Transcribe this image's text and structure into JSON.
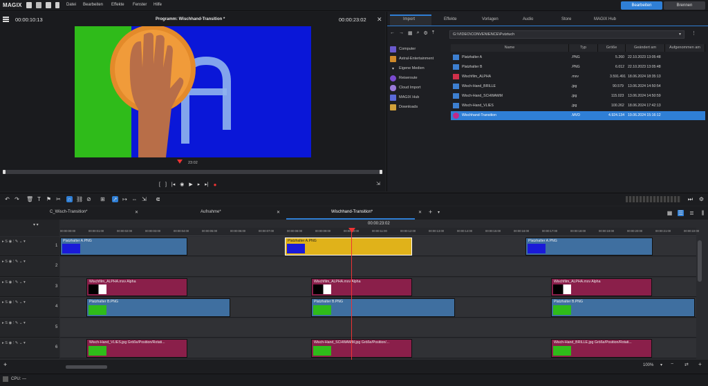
{
  "app": {
    "brand": "MAGIX"
  },
  "menu": [
    "Datei",
    "Bearbeiten",
    "Effekte",
    "Fenster",
    "Hilfe"
  ],
  "top_buttons": {
    "edit": "Bearbeiten",
    "burn": "Brennen"
  },
  "program": {
    "title": "Programm: Wischhand-Transition *",
    "time_left": "00:00:10:13",
    "time_right": "00:00:23:02",
    "position": "23:02"
  },
  "media_tabs": [
    "Import",
    "Effekte",
    "Vorlagen",
    "Audio",
    "Store",
    "MAGIX Hub"
  ],
  "path": "G:\\VIDEO\\CONVENIENCE\\Putztuch",
  "sidebar": [
    "Computer",
    "Astral-Entertainment",
    "Eigene Medien",
    "Reiseroute",
    "Cloud Import",
    "MAGIX Hub",
    "Downloads"
  ],
  "file_columns": [
    "Name",
    "Typ",
    "Größe",
    "Geändert am",
    "Aufgenommen am"
  ],
  "files": [
    {
      "name": "Platzhalter A",
      "type": ".PNG",
      "size": "5.260",
      "date": "22.10.2023 13:05:48"
    },
    {
      "name": "Platzhalter B",
      "type": ".PNG",
      "size": "6.012",
      "date": "22.10.2023 13:05:48"
    },
    {
      "name": "Wischfilm_ALPHA",
      "type": ".mxv",
      "size": "3.591.491",
      "date": "18.06.2024 18:35:13"
    },
    {
      "name": "Wisch-Hand_BRILLE",
      "type": ".jpg",
      "size": "90.579",
      "date": "13.06.2024 14:50:54"
    },
    {
      "name": "Wisch-Hand_SCHWAMM",
      "type": ".jpg",
      "size": "115.023",
      "date": "13.06.2024 14:50:59"
    },
    {
      "name": "Wisch-Hand_VLIES",
      "type": ".jpg",
      "size": "100.262",
      "date": "18.06.2024 17:42:13"
    },
    {
      "name": "Wischhand-Transition",
      "type": ".MVD",
      "size": "4.924.134",
      "date": "19.06.2024 15:16:12"
    }
  ],
  "timeline_tabs": [
    "C_Wisch-Transition*",
    "Aufnahme*",
    "Wischhand-Transition*"
  ],
  "timeline_position": "00:00:23:02",
  "ruler": [
    "00:00:00:00",
    "00:00:01:00",
    "00:00:02:00",
    "00:00:03:00",
    "00:00:04:00",
    "00:00:05:00",
    "00:00:06:00",
    "00:00:07:00",
    "00:00:08:00",
    "00:00:09:00",
    "00:00:10:00",
    "00:00:11:00",
    "00:00:12:00",
    "00:00:13:00",
    "00:00:14:00",
    "00:00:15:00",
    "00:00:16:00",
    "00:00:17:00",
    "00:00:18:00",
    "00:00:19:00",
    "00:00:20:00",
    "00:00:21:00",
    "00:00:22:00"
  ],
  "track_numbers": [
    "1",
    "2",
    "3",
    "4",
    "5",
    "6"
  ],
  "clips": {
    "ph_a": "Platzhalter A.PNG",
    "ph_b": "Platzhalter B.PNG",
    "alpha": "Wischfilm_ALPHA.mxv Alpha",
    "vlies": "Wisch-Hand_VLIES.jpg  Größe/Position/Rotati...",
    "schwamm": "Wisch-Hand_SCHWAMM.jpg  Größe/Position/...",
    "brille": "Wisch-Hand_BRILLE.jpg  Größe/Position/Rotati..."
  },
  "zoom": "100%",
  "status": "CPU: —",
  "colors": {
    "accent": "#2f7fd6",
    "clip_blue": "#3f6fa0",
    "clip_magenta": "#8a1f4a",
    "clip_yellow": "#e0b21a",
    "screen_blue": "#0a17d8",
    "screen_green": "#2fbb1a"
  }
}
